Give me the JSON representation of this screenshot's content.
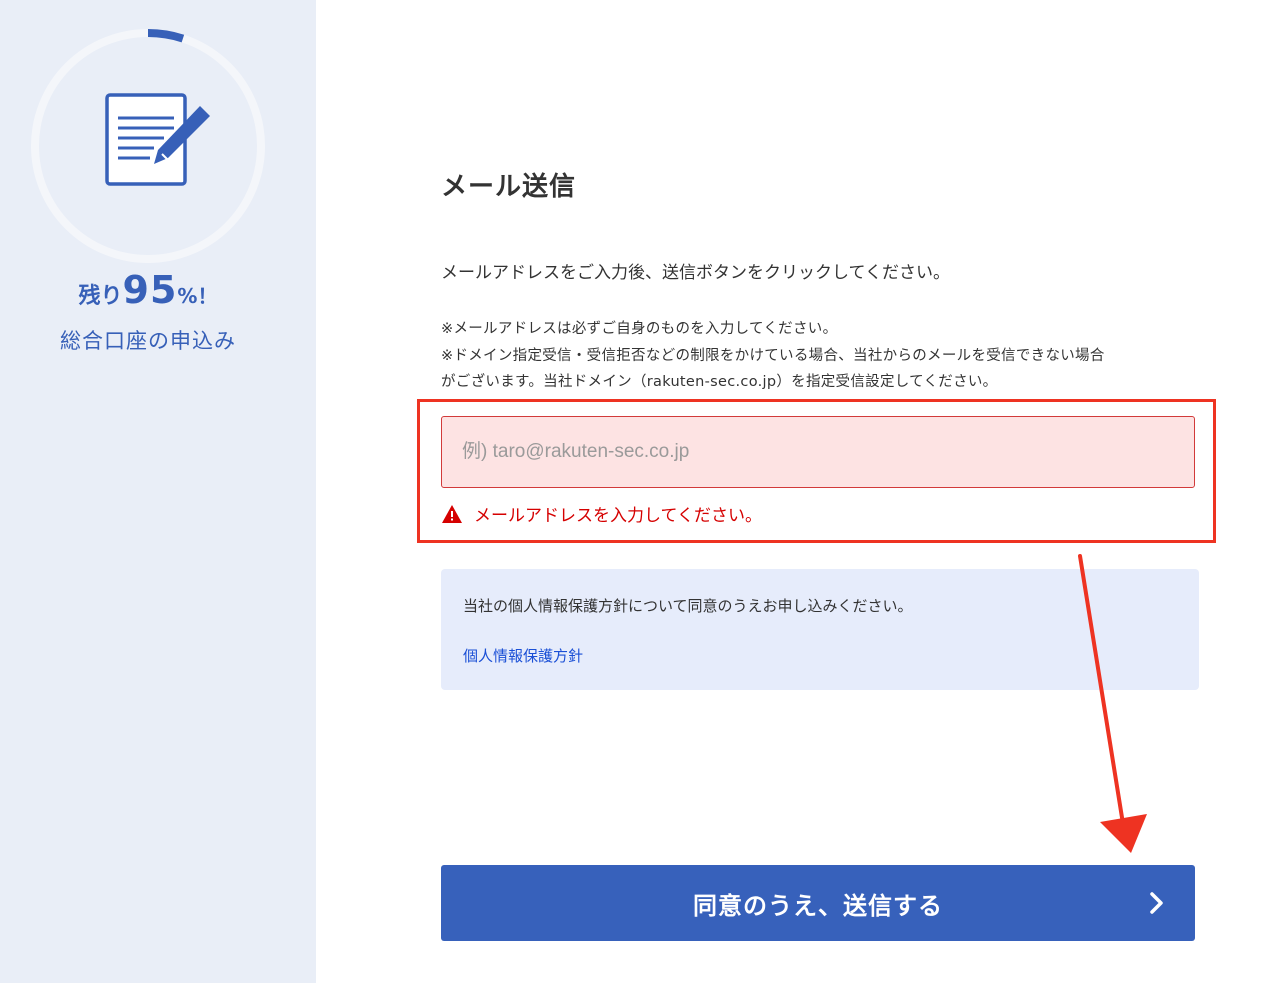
{
  "sidebar": {
    "progress_percent": 5,
    "remaining_prefix": "残り",
    "remaining_number": "95",
    "remaining_suffix": "%！",
    "title": "総合口座の申込み",
    "icon": "document-edit-icon",
    "accent_color": "#3760b8"
  },
  "main": {
    "title": "メール送信",
    "lead": "メールアドレスをご入力後、送信ボタンをクリックしてください。",
    "notes": [
      "※メールアドレスは必ずご自身のものを入力してください。",
      "※ドメイン指定受信・受信拒否などの制限をかけている場合、当社からのメールを受信できない場合",
      "がございます。当社ドメイン（rakuten-sec.co.jp）を指定受信設定してください。"
    ],
    "email": {
      "value": "",
      "placeholder": "例) taro@rakuten-sec.co.jp"
    },
    "error": {
      "icon": "warning-icon",
      "text": "メールアドレスを入力してください。",
      "color": "#d50000"
    },
    "privacy": {
      "text": "当社の個人情報保護方針について同意のうえお申し込みください。",
      "link_label": "個人情報保護方針"
    },
    "submit": {
      "label": "同意のうえ、送信する",
      "icon": "chevron-right-icon",
      "color": "#3761bb"
    }
  },
  "annotation": {
    "highlight_color": "#ee3322",
    "arrow_icon": "arrow-down-icon"
  }
}
